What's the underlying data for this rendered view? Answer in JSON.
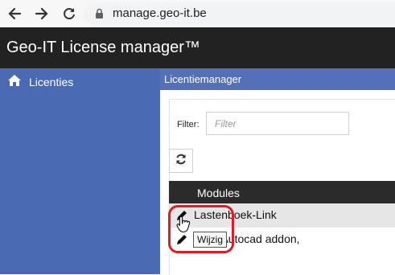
{
  "browser": {
    "url": "manage.geo-it.be"
  },
  "app": {
    "title": "Geo-IT License manager™"
  },
  "sidebar": {
    "items": [
      {
        "label": "Licenties",
        "icon": "home-icon"
      }
    ]
  },
  "panel": {
    "title": "Licentiemanager",
    "filter": {
      "label": "Filter:",
      "placeholder": "Filter",
      "value": ""
    },
    "refresh_icon": "refresh-icon",
    "table": {
      "column_header": "Modules",
      "rows": [
        {
          "name": "Lastenboek-Link",
          "icon": "edit-icon"
        },
        {
          "name": "Meld Autocad addon,",
          "icon": "edit-icon"
        }
      ]
    },
    "tooltip": "Wijzig"
  },
  "colors": {
    "titlebar": "#222222",
    "sidebar": "#4a6ab4",
    "panel_header": "#5470b8",
    "table_header": "#2b2b2b",
    "highlight": "#e01b24"
  }
}
